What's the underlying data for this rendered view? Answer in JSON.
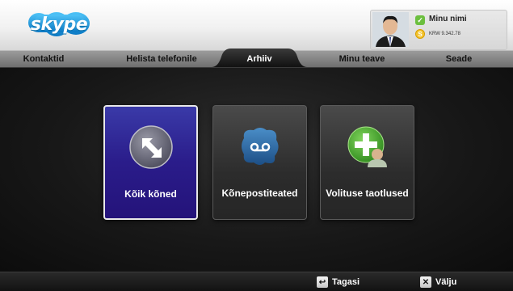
{
  "header": {
    "logo_text": "skype",
    "user": {
      "name": "Minu nimi",
      "credit": "KRW 9.342.78"
    }
  },
  "tabs": [
    {
      "label": "Kontaktid",
      "active": false
    },
    {
      "label": "Helista telefonile",
      "active": false
    },
    {
      "label": "Arhiiv",
      "active": true
    },
    {
      "label": "Minu teave",
      "active": false
    },
    {
      "label": "Seade",
      "active": false
    }
  ],
  "tiles": [
    {
      "label": "Kõik kõned",
      "icon": "all-calls-icon",
      "selected": true
    },
    {
      "label": "Kõnepostiteated",
      "icon": "voicemail-icon",
      "selected": false
    },
    {
      "label": "Volituse taotlused",
      "icon": "authorization-request-icon",
      "selected": false
    }
  ],
  "bottom": {
    "back": {
      "key": "↩",
      "label": "Tagasi"
    },
    "exit": {
      "key": "✕",
      "label": "Välju"
    }
  },
  "colors": {
    "skype_blue": "#1ba1e2",
    "selected_tile": "#2a1c8a",
    "status_green": "#6cbf3f",
    "credit_gold": "#f4c430"
  }
}
